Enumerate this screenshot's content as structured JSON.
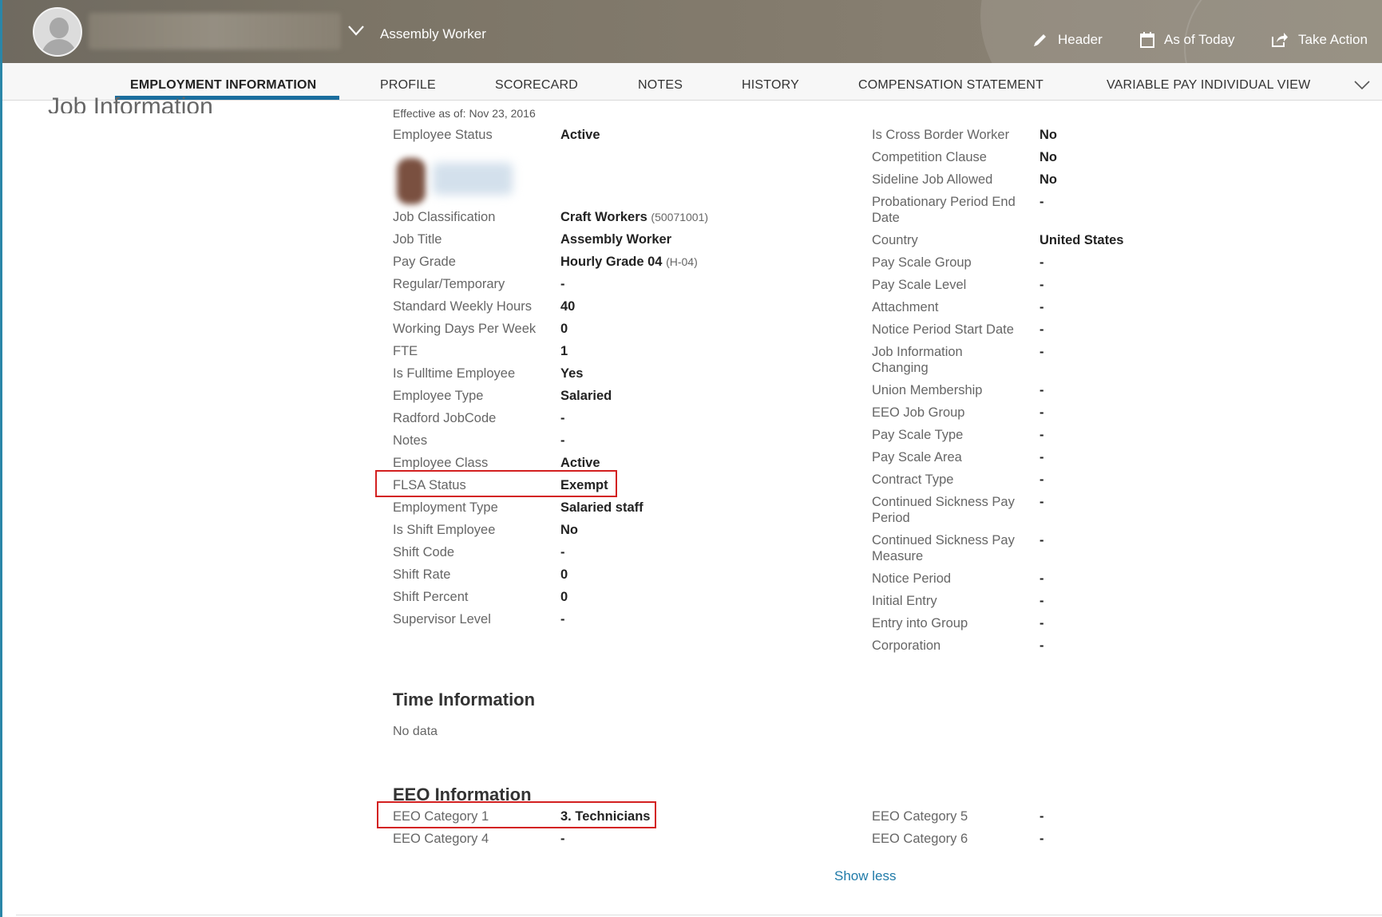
{
  "header": {
    "job_title": "Assembly Worker",
    "actions": [
      {
        "label": "Header",
        "icon": "pencil-icon"
      },
      {
        "label": "As of Today",
        "icon": "calendar-icon"
      },
      {
        "label": "Take Action",
        "icon": "share-icon"
      }
    ]
  },
  "tabs": [
    {
      "label": "EMPLOYMENT INFORMATION",
      "active": true
    },
    {
      "label": "PROFILE"
    },
    {
      "label": "SCORECARD"
    },
    {
      "label": "NOTES"
    },
    {
      "label": "HISTORY"
    },
    {
      "label": "COMPENSATION STATEMENT"
    },
    {
      "label": "VARIABLE PAY INDIVIDUAL VIEW"
    }
  ],
  "job_information": {
    "title": "Job Information",
    "effective": "Effective as of: Nov 23, 2016",
    "left": [
      {
        "label": "Employee Status",
        "value": "Active"
      },
      {
        "label": "Job Classification",
        "value": "Craft Workers",
        "code": "(50071001)"
      },
      {
        "label": "Job Title",
        "value": "Assembly Worker"
      },
      {
        "label": "Pay Grade",
        "value": "Hourly Grade 04",
        "code": "(H-04)"
      },
      {
        "label": "Regular/Temporary",
        "value": "-"
      },
      {
        "label": "Standard Weekly Hours",
        "value": "40"
      },
      {
        "label": "Working Days Per Week",
        "value": "0"
      },
      {
        "label": "FTE",
        "value": "1"
      },
      {
        "label": "Is Fulltime Employee",
        "value": "Yes"
      },
      {
        "label": "Employee Type",
        "value": "Salaried"
      },
      {
        "label": "Radford JobCode",
        "value": "-"
      },
      {
        "label": "Notes",
        "value": "-"
      },
      {
        "label": "Employee Class",
        "value": "Active"
      },
      {
        "label": "FLSA Status",
        "value": "Exempt"
      },
      {
        "label": "Employment Type",
        "value": "Salaried staff"
      },
      {
        "label": "Is Shift Employee",
        "value": "No"
      },
      {
        "label": "Shift Code",
        "value": "-"
      },
      {
        "label": "Shift Rate",
        "value": "0"
      },
      {
        "label": "Shift Percent",
        "value": "0"
      },
      {
        "label": "Supervisor Level",
        "value": "-"
      }
    ],
    "right": [
      {
        "label": "Is Cross Border Worker",
        "value": "No"
      },
      {
        "label": "Competition Clause",
        "value": "No"
      },
      {
        "label": "Sideline Job Allowed",
        "value": "No"
      },
      {
        "label": "Probationary Period End",
        "label2": "Date",
        "value": "-"
      },
      {
        "label": "Country",
        "value": "United States"
      },
      {
        "label": "Pay Scale Group",
        "value": "-"
      },
      {
        "label": "Pay Scale Level",
        "value": "-"
      },
      {
        "label": "Attachment",
        "value": "-"
      },
      {
        "label": "Notice Period Start Date",
        "value": "-"
      },
      {
        "label": "Job Information",
        "label2": "Changing",
        "value": "-"
      },
      {
        "label": "Union Membership",
        "value": "-"
      },
      {
        "label": "EEO Job Group",
        "value": "-"
      },
      {
        "label": "Pay Scale Type",
        "value": "-"
      },
      {
        "label": "Pay Scale Area",
        "value": "-"
      },
      {
        "label": "Contract Type",
        "value": "-"
      },
      {
        "label": "Continued Sickness Pay",
        "label2": "Period",
        "value": "-"
      },
      {
        "label": "Continued Sickness Pay",
        "label2": "Measure",
        "value": "-"
      },
      {
        "label": "Notice Period",
        "value": "-"
      },
      {
        "label": "Initial Entry",
        "value": "-"
      },
      {
        "label": "Entry into Group",
        "value": "-"
      },
      {
        "label": "Corporation",
        "value": "-"
      }
    ]
  },
  "time_information": {
    "title": "Time Information",
    "empty": "No data"
  },
  "eeo_information": {
    "title": "EEO Information",
    "left": [
      {
        "label": "EEO Category 1",
        "value": "3. Technicians"
      },
      {
        "label": "EEO Category 4",
        "value": "-"
      }
    ],
    "right": [
      {
        "label": "EEO Category 5",
        "value": "-"
      },
      {
        "label": "EEO Category 6",
        "value": "-"
      }
    ]
  },
  "show_less": "Show less"
}
